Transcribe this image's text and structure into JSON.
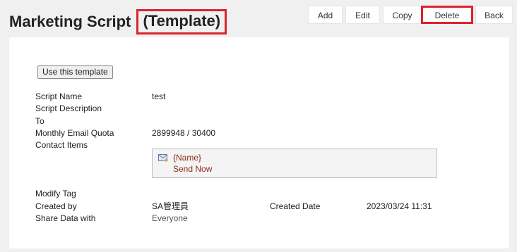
{
  "header": {
    "title_main": "Marketing Script ",
    "title_suffix": "(Template)"
  },
  "toolbar": {
    "add_label": "Add",
    "edit_label": "Edit",
    "copy_label": "Copy",
    "delete_label": "Delete",
    "back_label": "Back"
  },
  "form": {
    "use_template_label": "Use this template",
    "script_name_label": "Script Name",
    "script_name_value": "test",
    "script_description_label": "Script Description",
    "to_label": "To",
    "monthly_quota_label": "Monthly Email Quota",
    "monthly_quota_value": "2899948 / 30400",
    "contact_items_label": "Contact Items",
    "contact_item": {
      "icon": "mail-icon",
      "name": "{Name}",
      "action": "Send Now"
    },
    "modify_tag_label": "Modify Tag",
    "created_by_label": "Created by",
    "created_by_value": "SA管理員",
    "created_date_label": "Created Date",
    "created_date_value": "2023/03/24 11:31",
    "share_with_label": "Share Data with",
    "share_with_value": "Everyone"
  },
  "colors": {
    "highlight": "#d9242a",
    "link": "#8b2a1c"
  }
}
